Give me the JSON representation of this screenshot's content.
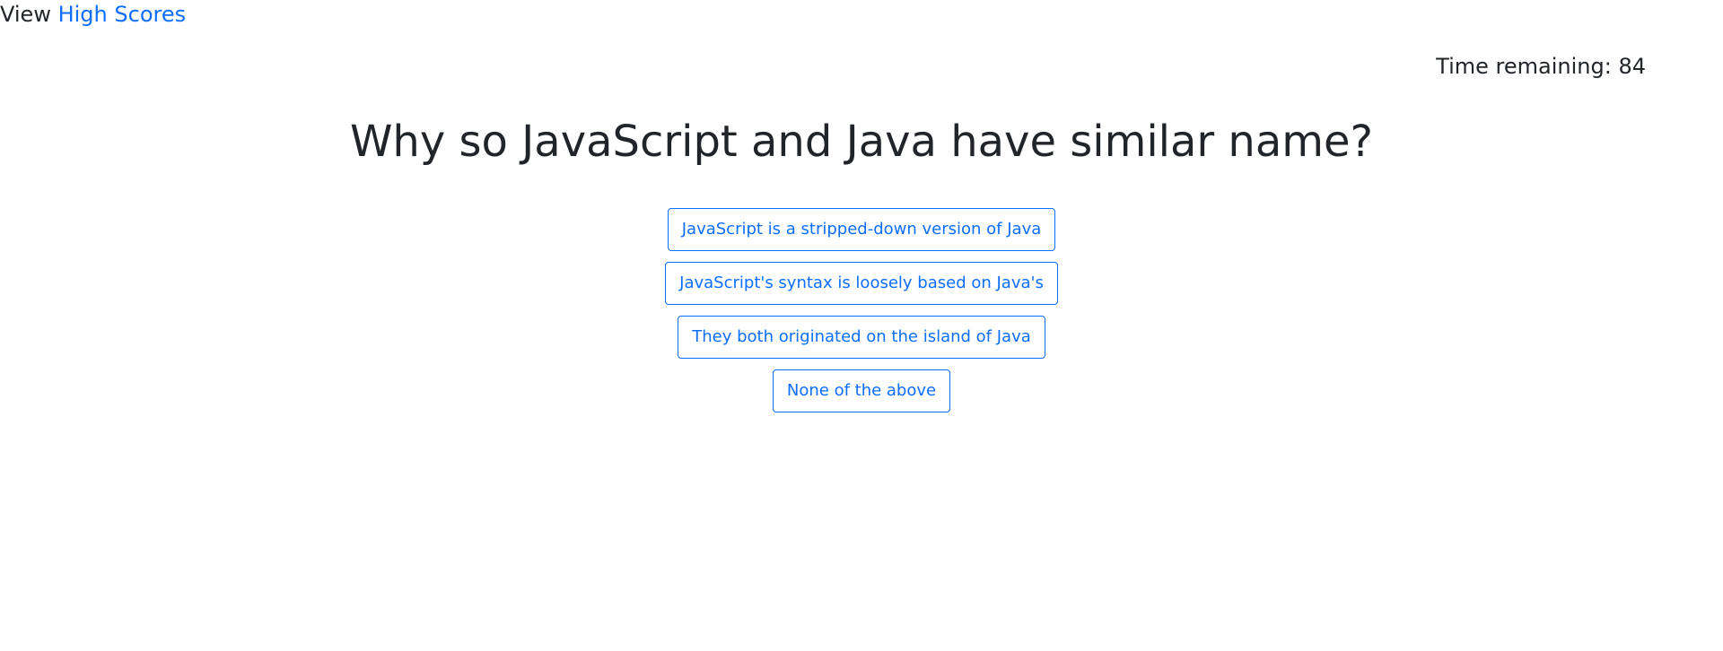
{
  "nav": {
    "prefix": "View",
    "link": "High Scores"
  },
  "timer": {
    "label": "Time remaining:",
    "value": "84"
  },
  "question": {
    "text": "Why so JavaScript and Java have similar name?"
  },
  "answers": [
    "JavaScript is a stripped-down version of Java",
    "JavaScript's syntax is loosely based on Java's",
    "They both originated on the island of Java",
    "None of the above"
  ],
  "colors": {
    "accent": "#0d6efd",
    "text": "#212529",
    "background": "#ffffff"
  }
}
